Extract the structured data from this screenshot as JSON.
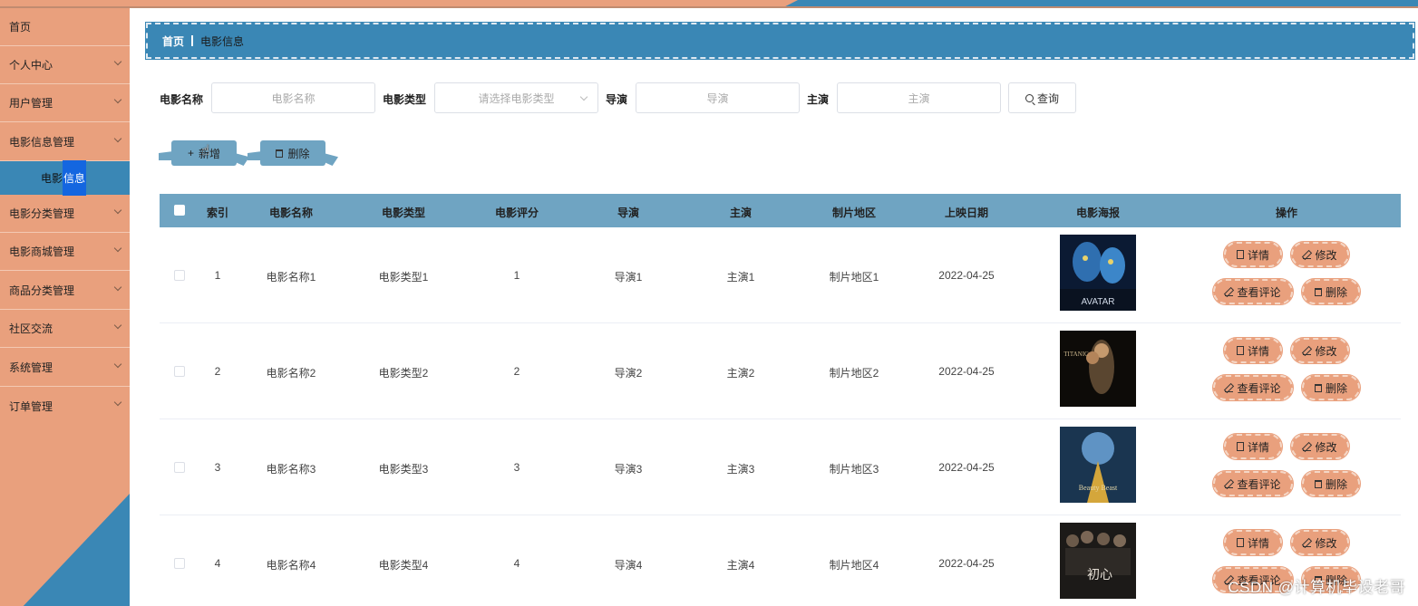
{
  "sidebar": {
    "items": [
      {
        "label": "首页",
        "has_chevron": false
      },
      {
        "label": "个人中心",
        "has_chevron": true
      },
      {
        "label": "用户管理",
        "has_chevron": true
      },
      {
        "label": "电影信息管理",
        "has_chevron": true
      },
      {
        "label": "电影分类管理",
        "has_chevron": true
      },
      {
        "label": "电影商城管理",
        "has_chevron": true
      },
      {
        "label": "商品分类管理",
        "has_chevron": true
      },
      {
        "label": "社区交流",
        "has_chevron": true
      },
      {
        "label": "系统管理",
        "has_chevron": true
      },
      {
        "label": "订单管理",
        "has_chevron": true
      }
    ],
    "sub_item": {
      "label_a": "电影",
      "label_b": "信息"
    }
  },
  "breadcrumb": {
    "home": "首页",
    "current": "电影信息"
  },
  "search": {
    "name_label": "电影名称",
    "name_placeholder": "电影名称",
    "type_label": "电影类型",
    "type_placeholder": "请选择电影类型",
    "director_label": "导演",
    "director_placeholder": "导演",
    "actor_label": "主演",
    "actor_placeholder": "主演",
    "query_button": "查询"
  },
  "actions": {
    "add_button": "新增",
    "delete_button": "删除"
  },
  "table": {
    "headers": [
      "索引",
      "电影名称",
      "电影类型",
      "电影评分",
      "导演",
      "主演",
      "制片地区",
      "上映日期",
      "电影海报",
      "操作"
    ],
    "rows": [
      {
        "index": "1",
        "name": "电影名称1",
        "type": "电影类型1",
        "rating": "1",
        "director": "导演1",
        "actor": "主演1",
        "region": "制片地区1",
        "date": "2022-04-25",
        "poster": "avatar-poster",
        "poster_text": "AVATAR"
      },
      {
        "index": "2",
        "name": "电影名称2",
        "type": "电影类型2",
        "rating": "2",
        "director": "导演2",
        "actor": "主演2",
        "region": "制片地区2",
        "date": "2022-04-25",
        "poster": "titanic-poster",
        "poster_text": "TITANIC"
      },
      {
        "index": "3",
        "name": "电影名称3",
        "type": "电影类型3",
        "rating": "3",
        "director": "导演3",
        "actor": "主演3",
        "region": "制片地区3",
        "date": "2022-04-25",
        "poster": "beauty-beast-poster",
        "poster_text": "Beauty Beast"
      },
      {
        "index": "4",
        "name": "电影名称4",
        "type": "电影类型4",
        "rating": "4",
        "director": "导演4",
        "actor": "主演4",
        "region": "制片地区4",
        "date": "2022-04-25",
        "poster": "chinese-film-poster",
        "poster_text": "初心"
      }
    ],
    "row_buttons": {
      "detail": "详情",
      "edit": "修改",
      "comments": "查看评论",
      "delete": "删除"
    }
  },
  "colors": {
    "primary_blue": "#3a87b5",
    "salmon": "#e9a07d",
    "header_blue": "#6fa4c2",
    "highlight": "#1466e0"
  },
  "watermark": "CSDN @计算机毕设老哥"
}
